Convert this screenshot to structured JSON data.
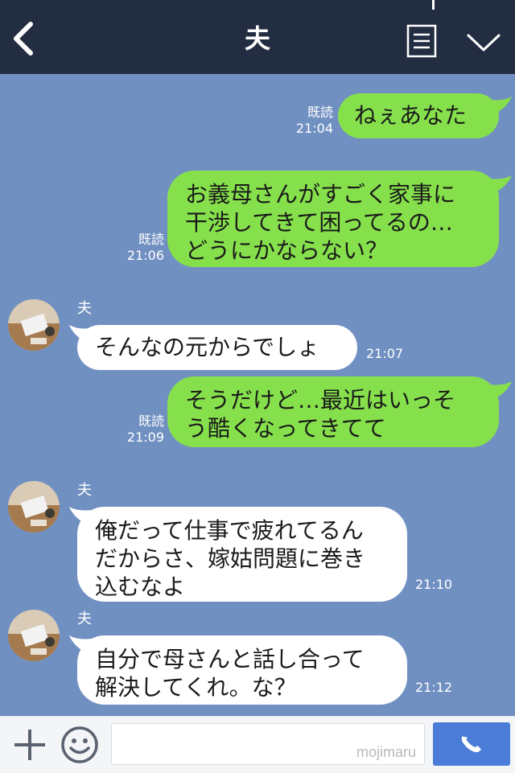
{
  "header": {
    "title": "夫"
  },
  "messages": [
    {
      "side": "right",
      "text": "ねぇあなた",
      "read": "既読",
      "time": "21:04"
    },
    {
      "side": "right",
      "lines": [
        "お義母さんがすごく家事に",
        "干渉してきて困ってるの…",
        "どうにかならない？"
      ],
      "read": "既読",
      "time": "21:06"
    },
    {
      "side": "left",
      "sender": "夫",
      "text": "そんなの元からでしょ",
      "time": "21:07"
    },
    {
      "side": "right",
      "lines": [
        "そうだけど…最近はいっそ",
        "う酷くなってきてて"
      ],
      "read": "既読",
      "time": "21:09"
    },
    {
      "side": "left",
      "sender": "夫",
      "lines": [
        "俺だって仕事で疲れてるん",
        "だからさ、嫁姑問題に巻き",
        "込むなよ"
      ],
      "time": "21:10"
    },
    {
      "side": "left",
      "sender": "夫",
      "lines": [
        "自分で母さんと話し合って",
        "解決してくれ。な？"
      ],
      "time": "21:12"
    }
  ],
  "input": {
    "watermark": "mojimaru"
  },
  "colors": {
    "header": "#232d42",
    "background": "#7190c2",
    "sent_bubble": "#86e04c",
    "received_bubble": "#ffffff",
    "call_button": "#4b7dd8"
  },
  "icons": [
    "back-arrow-icon",
    "menu-list-icon",
    "chevron-down-icon",
    "plus-icon",
    "emoji-icon",
    "phone-icon"
  ]
}
